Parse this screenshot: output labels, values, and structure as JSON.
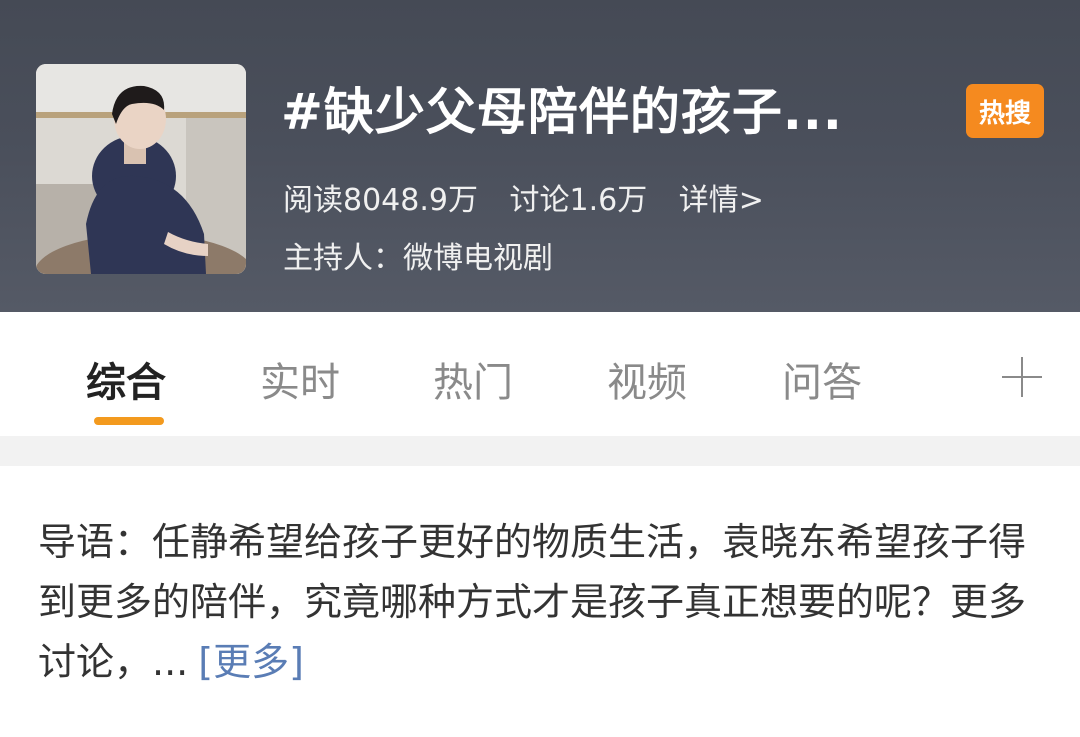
{
  "header": {
    "title": "#缺少父母陪伴的孩子...",
    "badge": "热搜",
    "reads": "阅读8048.9万",
    "discussions": "讨论1.6万",
    "details_link": "详情>",
    "host": "主持人：微博电视剧"
  },
  "tabs": [
    {
      "label": "综合",
      "active": true
    },
    {
      "label": "实时",
      "active": false
    },
    {
      "label": "热门",
      "active": false
    },
    {
      "label": "视频",
      "active": false
    },
    {
      "label": "问答",
      "active": false
    }
  ],
  "intro": {
    "text": "导语：任静希望给孩子更好的物质生活，袁晓东希望孩子得到更多的陪伴，究竟哪种方式才是孩子真正想要的呢？更多讨论，...",
    "more_label": "[更多]"
  },
  "colors": {
    "accent": "#f39a1e",
    "badge": "#f58a1f",
    "link": "#5a7db5"
  },
  "icons": {
    "add_tab": "plus-icon"
  }
}
